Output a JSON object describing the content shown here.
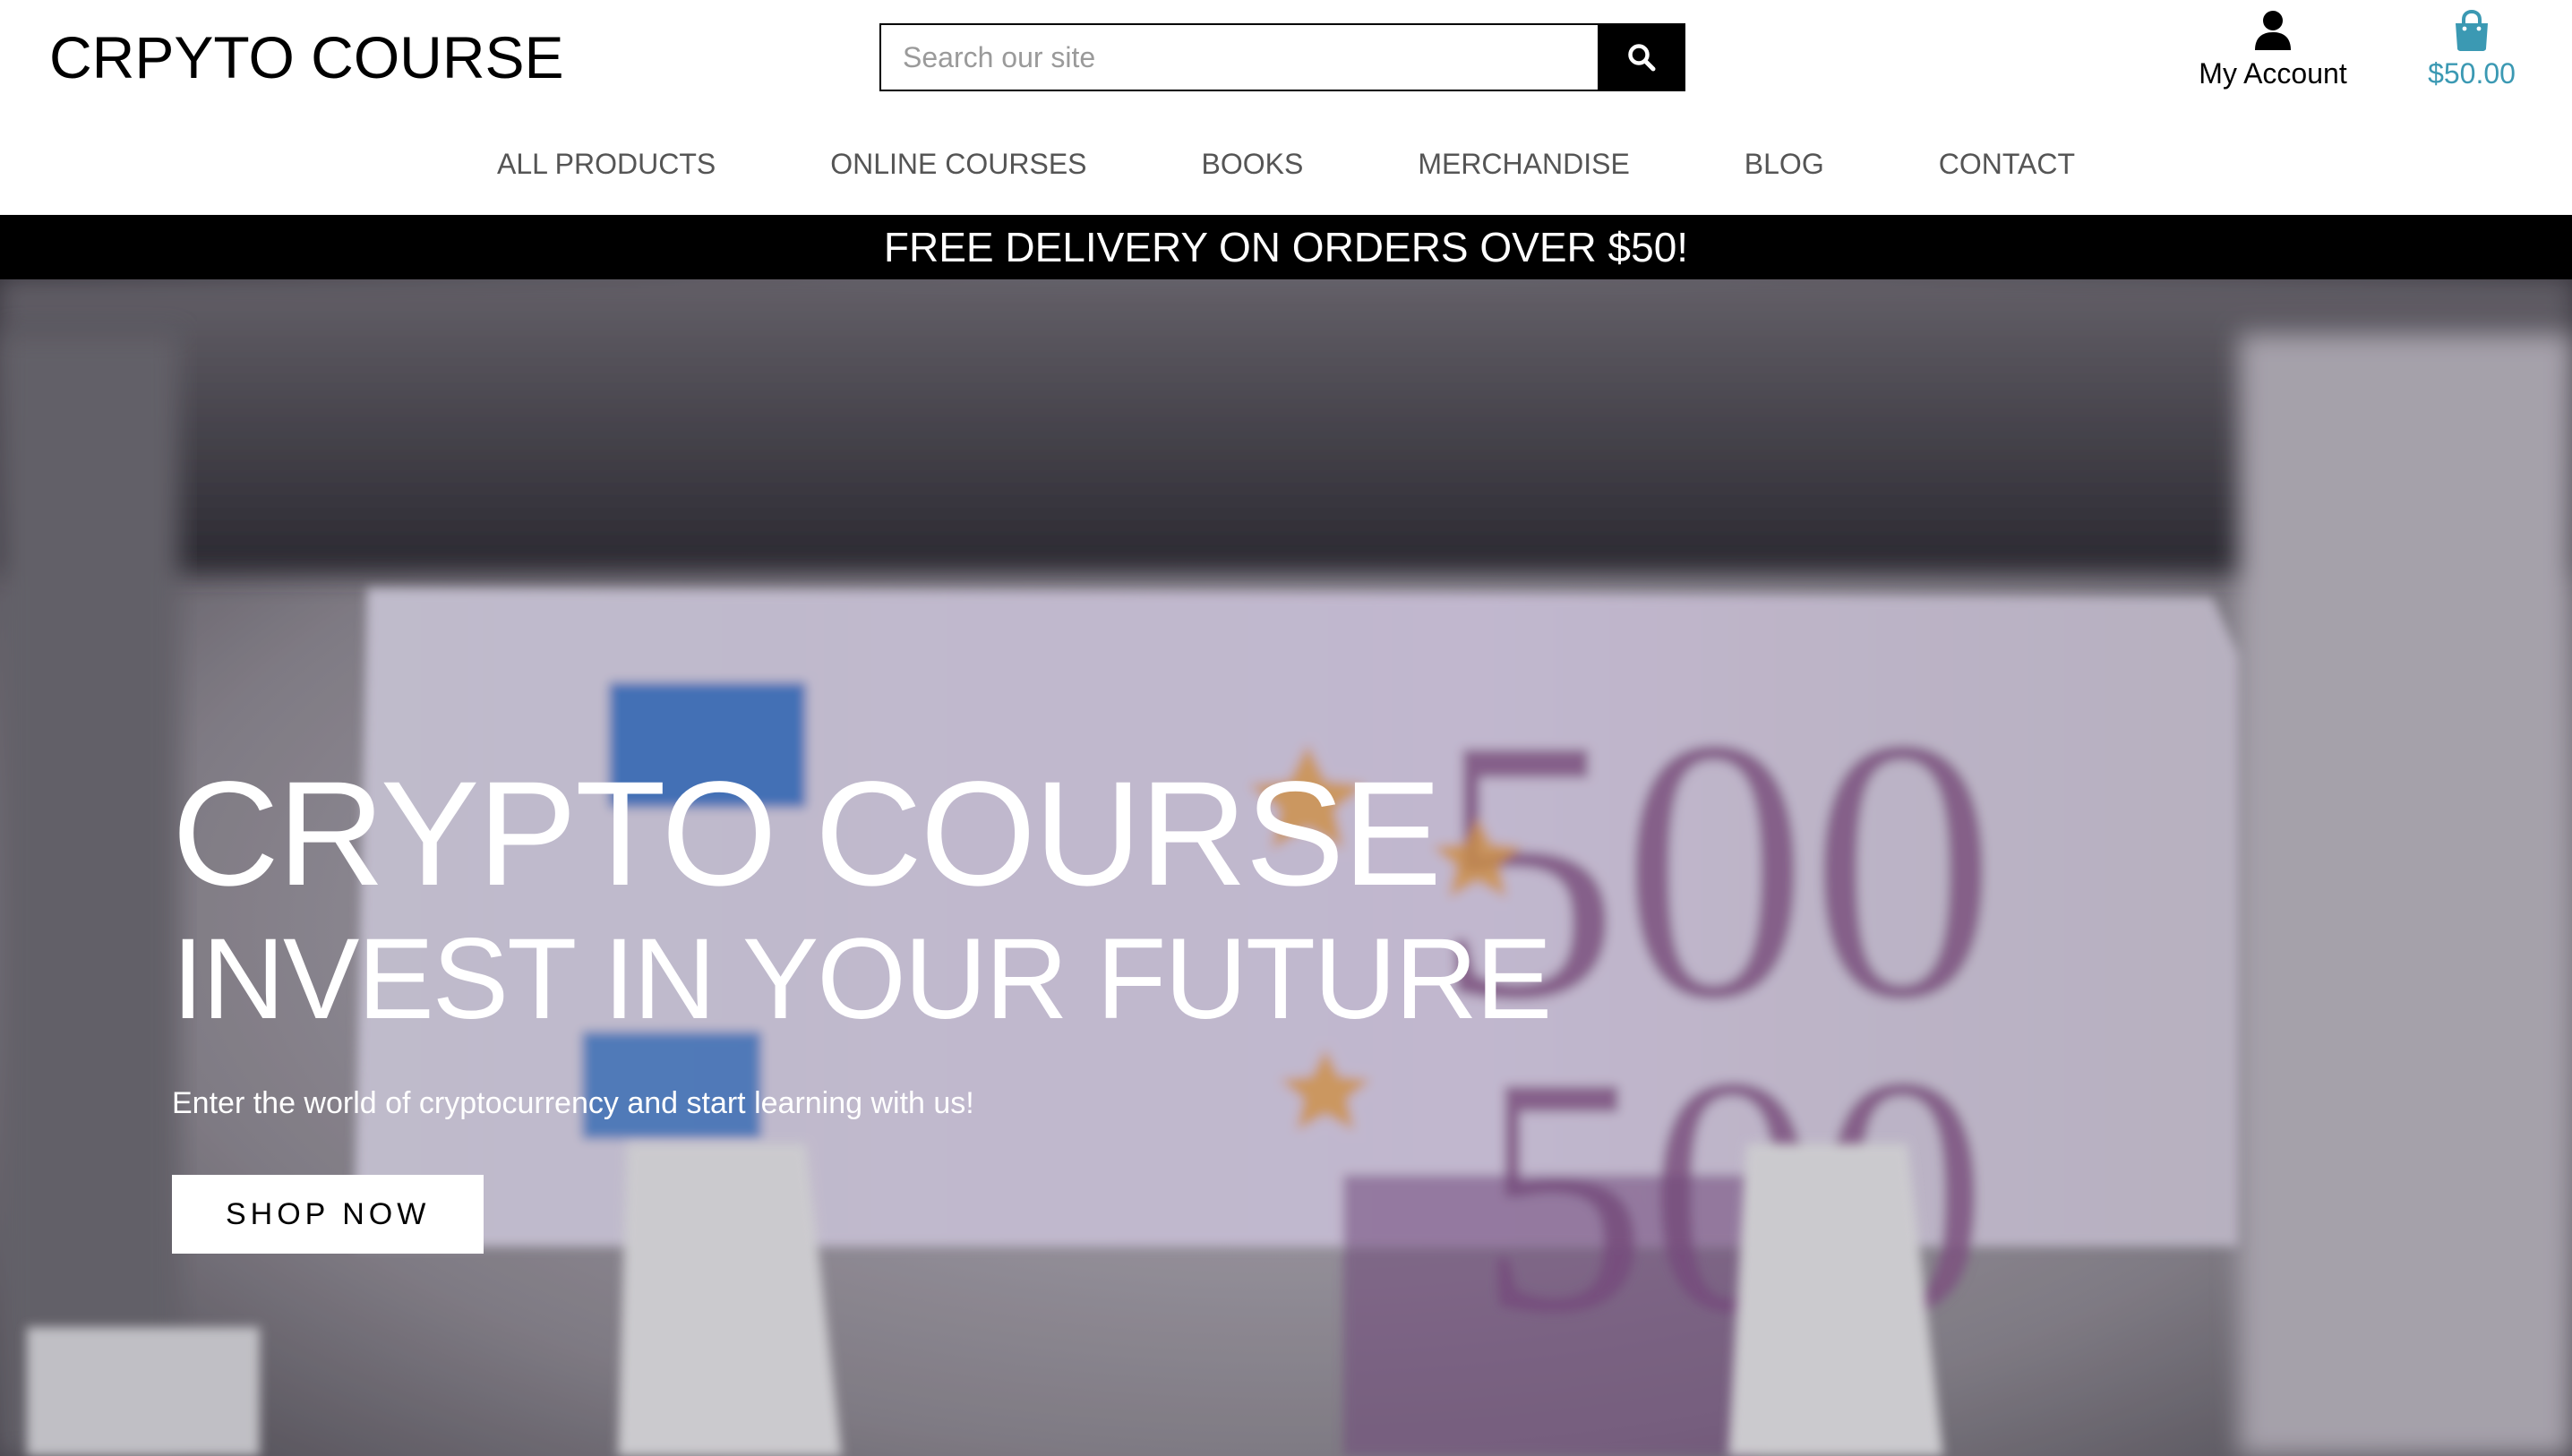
{
  "header": {
    "logo": "CRPYTO COURSE",
    "search": {
      "placeholder": "Search our site",
      "value": ""
    },
    "account_label": "My Account",
    "bag_total": "$50.00",
    "icons": {
      "search": "search-icon",
      "account": "user-icon",
      "bag": "shopping-bag-icon"
    }
  },
  "nav": {
    "items": [
      {
        "label": "ALL PRODUCTS"
      },
      {
        "label": "ONLINE COURSES"
      },
      {
        "label": "BOOKS"
      },
      {
        "label": "MERCHANDISE"
      },
      {
        "label": "BLOG"
      },
      {
        "label": "CONTACT"
      }
    ]
  },
  "banner": {
    "text": "FREE DELIVERY ON ORDERS OVER $50!"
  },
  "hero": {
    "title": "CRYPTO COURSE",
    "subtitle": "INVEST IN YOUR FUTURE",
    "text": "Enter the world of cryptocurrency and start learning with us!",
    "cta": "SHOP NOW",
    "banknote_value": "500"
  },
  "colors": {
    "accent": "#3b99b3",
    "banner_bg": "#000000",
    "note_purple": "#8a5a8c"
  }
}
